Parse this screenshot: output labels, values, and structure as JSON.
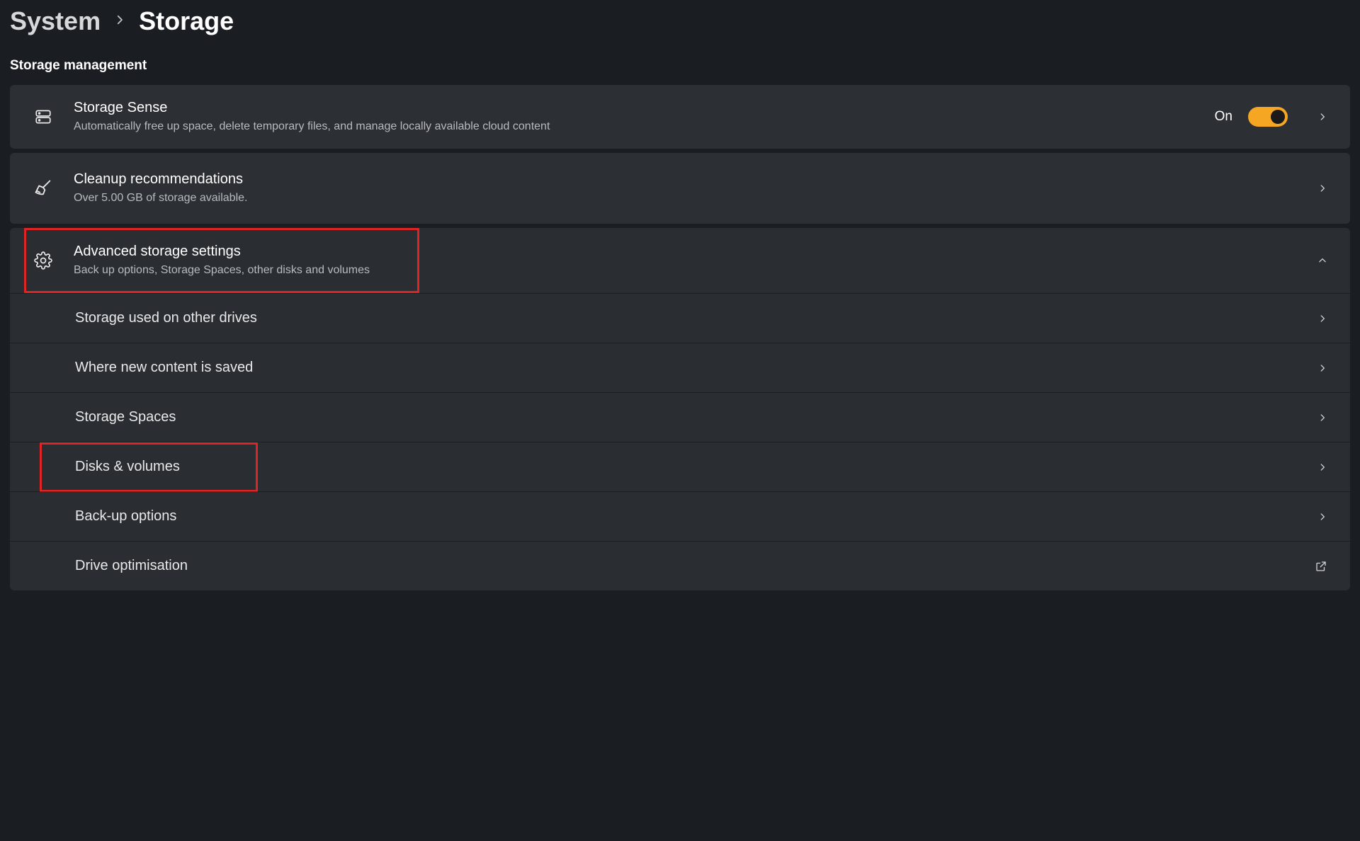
{
  "breadcrumb": {
    "parent": "System",
    "title": "Storage"
  },
  "section_heading": "Storage management",
  "storage_sense": {
    "title": "Storage Sense",
    "subtitle": "Automatically free up space, delete temporary files, and manage locally available cloud content",
    "toggle_label": "On",
    "toggle_on": true
  },
  "cleanup": {
    "title": "Cleanup recommendations",
    "subtitle": "Over 5.00 GB of storage available."
  },
  "advanced": {
    "title": "Advanced storage settings",
    "subtitle": "Back up options, Storage Spaces, other disks and volumes",
    "expanded": true,
    "items": [
      {
        "label": "Storage used on other drives",
        "icon": "chevron-right"
      },
      {
        "label": "Where new content is saved",
        "icon": "chevron-right"
      },
      {
        "label": "Storage Spaces",
        "icon": "chevron-right"
      },
      {
        "label": "Disks & volumes",
        "icon": "chevron-right",
        "highlighted": true
      },
      {
        "label": "Back-up options",
        "icon": "chevron-right"
      },
      {
        "label": "Drive optimisation",
        "icon": "open-external"
      }
    ]
  }
}
